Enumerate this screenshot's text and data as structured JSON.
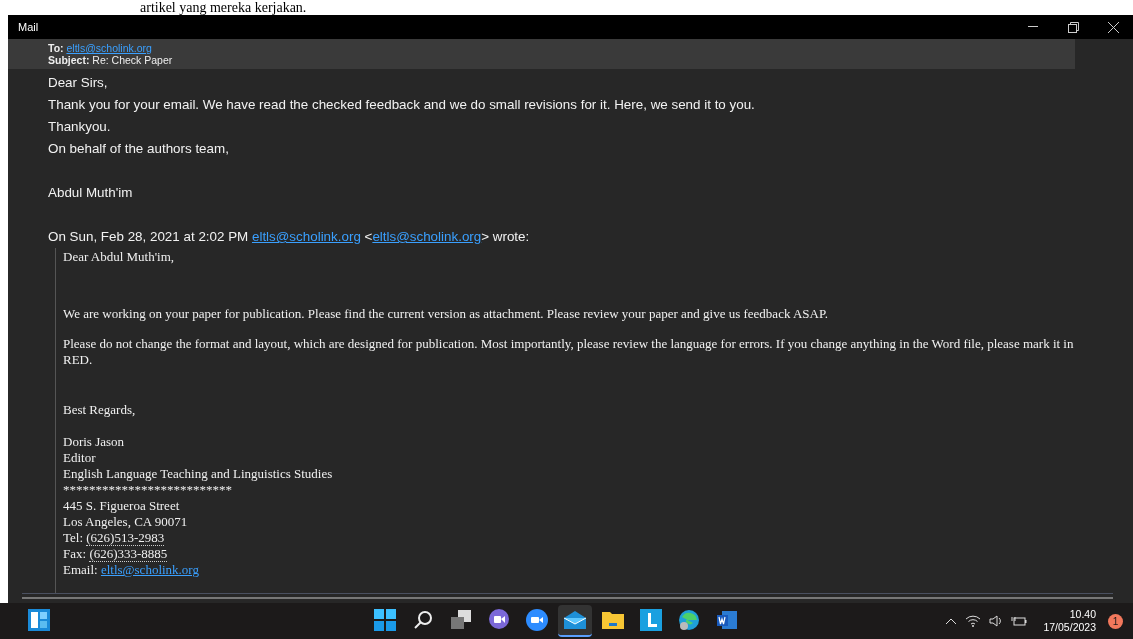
{
  "background_document": {
    "text": "artikel yang mereka kerjakan."
  },
  "window": {
    "title": "Mail"
  },
  "header": {
    "to_label": "To:",
    "to": "eltls@scholink.org",
    "subject_label": "Subject:",
    "subject": "Re: Check Paper"
  },
  "reply": {
    "paragraphs": [
      "Dear Sirs,",
      "Thank you for your email. We have read the checked feedback and we do small revisions for it. Here, we send it to you.",
      "Thankyou.",
      "On behalf of the authors team,"
    ],
    "signature": "Abdul Muth'im"
  },
  "quote_intro": {
    "parts": [
      {
        "kind": "text",
        "text": "On Sun, Feb 28, 2021 at 2:02 PM "
      },
      {
        "kind": "link",
        "text": "eltls@scholink.org"
      },
      {
        "kind": "text",
        "text": " <"
      },
      {
        "kind": "link",
        "text": "eltls@scholink.org"
      },
      {
        "kind": "text",
        "text": "> wrote:"
      }
    ]
  },
  "quoted": {
    "greeting": "Dear Abdul Muth'im,",
    "paragraphs": [
      "We are working on your paper for publication. Please find the current version as attachment. Please review your paper and give us feedback ASAP.",
      "Please do not change the format and layout, which are designed for publication. Most importantly, please review the language for errors. If you change anything in the Word file, please mark it in RED."
    ],
    "closing": "Best Regards,",
    "signature_lines": [
      {
        "kind": "text",
        "text": "Doris Jason"
      },
      {
        "kind": "text",
        "text": "Editor"
      },
      {
        "kind": "text",
        "text": "English Language Teaching and Linguistics Studies"
      },
      {
        "kind": "text",
        "text": "**************************"
      },
      {
        "kind": "text",
        "text": "445 S. Figueroa Street"
      },
      {
        "kind": "text",
        "text": "Los Angeles, CA 90071"
      },
      {
        "kind": "phone",
        "label": "Tel: ",
        "value": "(626)513-2983"
      },
      {
        "kind": "phone",
        "label": "Fax: ",
        "value": "(626)333-8885"
      },
      {
        "kind": "link",
        "label": "Email: ",
        "value": "eltls@scholink.org"
      }
    ]
  },
  "taskbar": {
    "apps": [
      {
        "kind": "start",
        "selected": false
      },
      {
        "kind": "search",
        "selected": false
      },
      {
        "kind": "taskview",
        "selected": false
      },
      {
        "kind": "chat",
        "selected": false
      },
      {
        "kind": "zoom",
        "selected": false
      },
      {
        "kind": "mail",
        "selected": true
      },
      {
        "kind": "files",
        "selected": false
      },
      {
        "kind": "letter",
        "selected": false
      },
      {
        "kind": "edge",
        "selected": false
      },
      {
        "kind": "word",
        "selected": false
      }
    ],
    "time": "10.40",
    "date": "17/05/2023",
    "notifications": "1"
  }
}
